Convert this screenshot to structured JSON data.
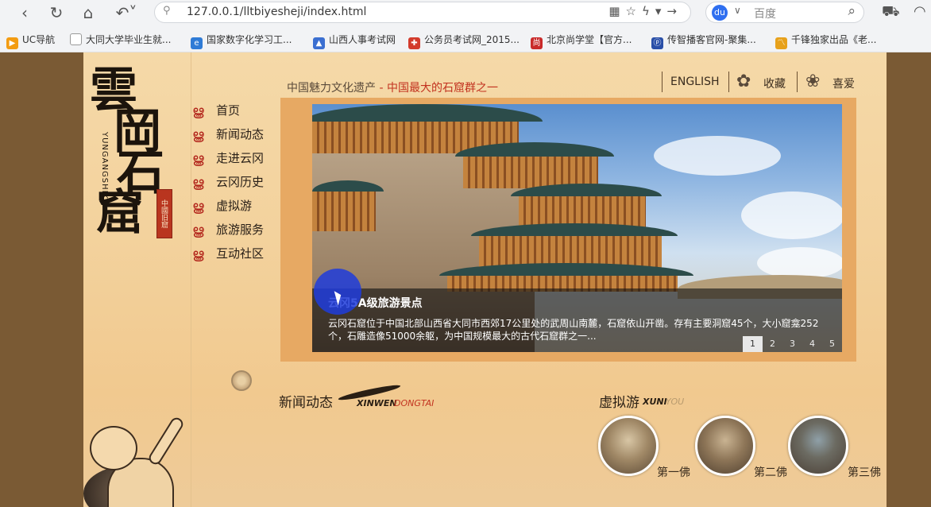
{
  "browser": {
    "url": "127.0.0.1/lltbiyesheji/index.html",
    "search_placeholder": "百度",
    "bookmarks": [
      {
        "label": "UC导航",
        "color": "#f39c12"
      },
      {
        "label": "大同大学毕业生就...",
        "color": "#999999"
      },
      {
        "label": "国家数字化学习工...",
        "color": "#2f7bd6"
      },
      {
        "label": "山西人事考试网",
        "color": "#3b6fd1"
      },
      {
        "label": "公务员考试网_2015...",
        "color": "#d33b2c"
      },
      {
        "label": "北京尚学堂【官方...",
        "color": "#c92a2a"
      },
      {
        "label": "传智播客官网-聚集...",
        "color": "#2a4fa8"
      },
      {
        "label": "千锋独家出品《老...",
        "color": "#e7a11b"
      }
    ]
  },
  "site": {
    "slogan_part1": "中国魅力文化遗产",
    "slogan_sep": " - ",
    "slogan_highlight": "中国最大的石窟群之一",
    "top_links": {
      "english": "ENGLISH",
      "favorite": "收藏",
      "homepage": "喜爱"
    },
    "logo": {
      "chars": [
        "雲",
        "岡",
        "石",
        "窟"
      ],
      "pinyin": "YUNGANGSHIKU",
      "seal": "中國旧窟"
    },
    "menu": [
      {
        "label": "首页"
      },
      {
        "label": "新闻动态"
      },
      {
        "label": "走进云冈"
      },
      {
        "label": "云冈历史"
      },
      {
        "label": "虚拟游"
      },
      {
        "label": "旅游服务"
      },
      {
        "label": "互动社区"
      }
    ],
    "slider": {
      "title": "云冈5A级旅游景点",
      "text": "云冈石窟位于中国北部山西省大同市西郊17公里处的武周山南麓，石窟依山开凿。存有主要洞窟45个，大小窟龛252个，石雕造像51000余躯，为中国规模最大的古代石窟群之一...",
      "pages": [
        "1",
        "2",
        "3",
        "4",
        "5"
      ],
      "active_page": "1"
    },
    "news": {
      "title": "新闻动态",
      "sub_en_1": "XINWEN",
      "sub_en_2": "DONGTAI"
    },
    "virtual_tour": {
      "title": "虚拟游",
      "sub_en_1": "XUNI",
      "sub_en_2": "YOU",
      "items": [
        {
          "label": "第一佛"
        },
        {
          "label": "第二佛"
        },
        {
          "label": "第三佛"
        }
      ]
    }
  },
  "colors": {
    "accent_red": "#c2321f",
    "page_bg": "#f3d29d",
    "outer_bg": "#7a5a34"
  }
}
